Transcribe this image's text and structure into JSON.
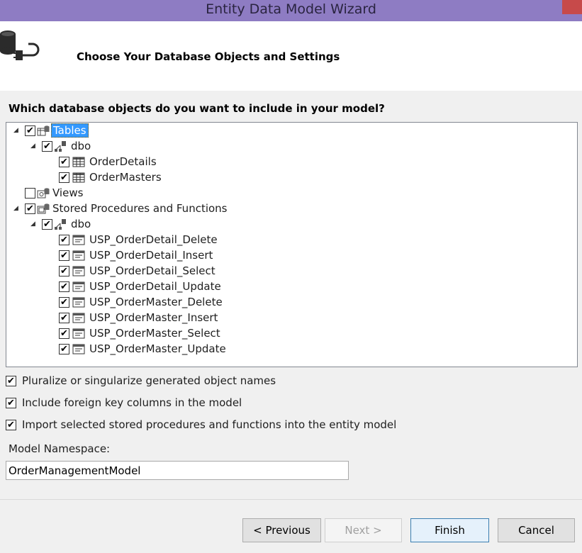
{
  "window": {
    "title": "Entity Data Model Wizard"
  },
  "header": {
    "heading": "Choose Your Database Objects and Settings",
    "icon": "database-connection-icon"
  },
  "question": "Which database objects do you want to include in your model?",
  "tree": {
    "tables": {
      "label": "Tables",
      "checked": true,
      "expanded": true,
      "selected": true,
      "schema": {
        "label": "dbo",
        "checked": true,
        "items": [
          {
            "label": "OrderDetails",
            "checked": true
          },
          {
            "label": "OrderMasters",
            "checked": true
          }
        ]
      }
    },
    "views": {
      "label": "Views",
      "checked": false
    },
    "procs": {
      "label": "Stored Procedures and Functions",
      "checked": true,
      "expanded": true,
      "schema": {
        "label": "dbo",
        "checked": true,
        "items": [
          {
            "label": "USP_OrderDetail_Delete",
            "checked": true
          },
          {
            "label": "USP_OrderDetail_Insert",
            "checked": true
          },
          {
            "label": "USP_OrderDetail_Select",
            "checked": true
          },
          {
            "label": "USP_OrderDetail_Update",
            "checked": true
          },
          {
            "label": "USP_OrderMaster_Delete",
            "checked": true
          },
          {
            "label": "USP_OrderMaster_Insert",
            "checked": true
          },
          {
            "label": "USP_OrderMaster_Select",
            "checked": true
          },
          {
            "label": "USP_OrderMaster_Update",
            "checked": true
          }
        ]
      }
    }
  },
  "options": {
    "pluralize": {
      "label": "Pluralize or singularize generated object names",
      "checked": true
    },
    "foreign_keys": {
      "label": "Include foreign key columns in the model",
      "checked": true
    },
    "import_procs": {
      "label": "Import selected stored procedures and functions into the entity model",
      "checked": true
    }
  },
  "namespace": {
    "label": "Model Namespace:",
    "value": "OrderManagementModel"
  },
  "buttons": {
    "previous": "< Previous",
    "next": "Next >",
    "finish": "Finish",
    "cancel": "Cancel"
  },
  "colors": {
    "titlebar": "#8e7cc3",
    "selection": "#3399ff",
    "close": "#c74a4a"
  }
}
